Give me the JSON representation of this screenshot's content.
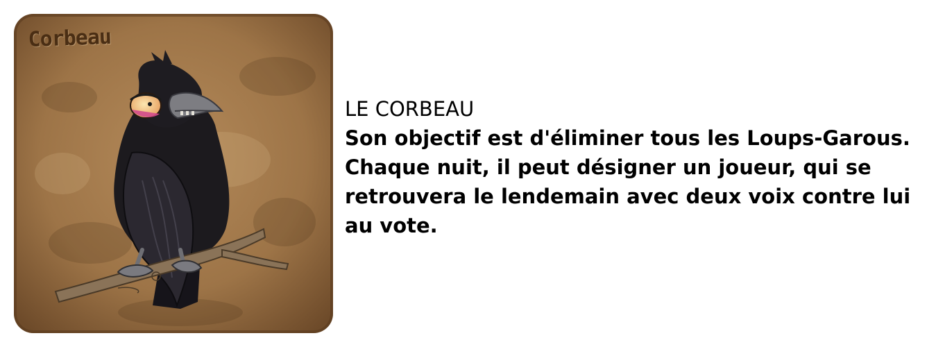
{
  "card": {
    "title": "Corbeau",
    "image_subject": "raven-illustration"
  },
  "description": {
    "heading": "LE CORBEAU",
    "text": "Son objectif est d'éliminer tous les Loups-Garous. Chaque nuit, il peut désigner un joueur, qui se retrouvera le lendemain avec deux voix contre lui au vote."
  },
  "colors": {
    "parchment": "#a37a4e",
    "parchment_dark": "#6e4b2a",
    "raven": "#1c1a1e",
    "beak": "#7d7d82",
    "branch": "#8a7358",
    "title_ink": "#4a2e14",
    "text": "#000000"
  }
}
